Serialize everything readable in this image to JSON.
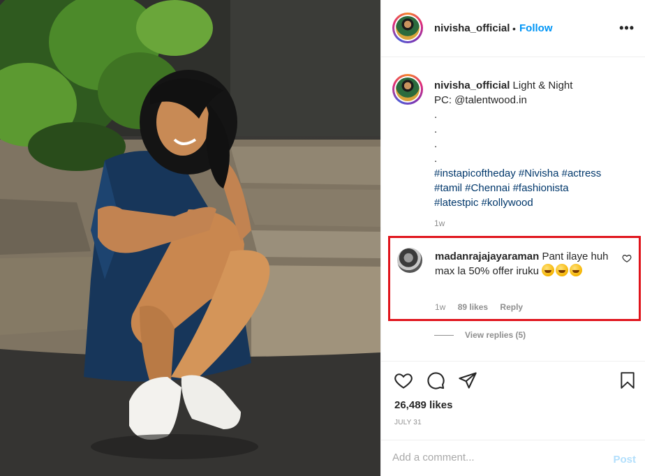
{
  "post": {
    "username": "nivisha_official",
    "follow_label": "Follow",
    "dot": "•",
    "more_label": "•••"
  },
  "caption": {
    "username": "nivisha_official",
    "text_line1": "Light & Night",
    "text_line2": "PC: @talentwood.in",
    "dots": [
      ".",
      ".",
      ".",
      "."
    ],
    "hashtags_line1": "#instapicoftheday #Nivisha #actress",
    "hashtags_line2": "#tamil #Chennai #fashionista",
    "hashtags_line3": "#latestpic #kollywood",
    "time": "1w"
  },
  "comment": {
    "username": "madanrajajayaraman",
    "text": "Pant ilaye huh max la 50% offer iruku",
    "time": "1w",
    "likes": "89 likes",
    "reply_label": "Reply",
    "highlight_color": "#e0131b"
  },
  "view_replies": "View replies (5)",
  "actions": {
    "icons": [
      "heart-icon",
      "comment-icon",
      "share-icon",
      "bookmark-icon"
    ],
    "likes_count": "26,489 likes",
    "date": "JULY 31"
  },
  "add_comment": {
    "placeholder": "Add a comment...",
    "post_label": "Post"
  },
  "colors": {
    "link_blue": "#0095f6",
    "hashtag_blue": "#00376b",
    "muted": "#8e8e8e"
  }
}
